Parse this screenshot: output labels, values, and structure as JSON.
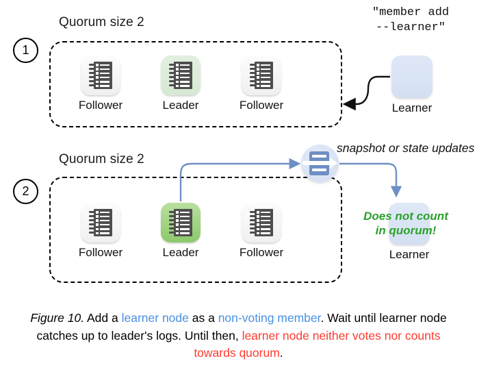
{
  "figure": {
    "number": "Figure 10.",
    "caption_parts": [
      {
        "text": "Figure 10.",
        "style": "italic"
      },
      {
        "text": " Add a ",
        "style": "plain"
      },
      {
        "text": "learner node",
        "style": "blue"
      },
      {
        "text": " as a ",
        "style": "plain"
      },
      {
        "text": "non-voting member",
        "style": "blue"
      },
      {
        "text": ". Wait until learner node catches up to leader's logs. Until then, ",
        "style": "plain"
      },
      {
        "text": "learner node neither votes nor counts towards quorum",
        "style": "red"
      },
      {
        "text": ".",
        "style": "plain"
      }
    ],
    "caption_plain": "Figure 10. Add a learner node as a non-voting member. Wait until learner node catches up to leader's logs. Until then, learner node neither votes nor counts towards quorum."
  },
  "colors": {
    "learner_blue": "#4a90e2",
    "warning_red": "#ff3b30",
    "quorum_green": "#2aa02a",
    "leader_green_pale": "#d6e9d2",
    "leader_green_strong": "#8cc96a",
    "learner_box_blue": "#d4e0f2",
    "arrow_blue": "#6e8fc4",
    "arrow_black": "#111111"
  },
  "panels": [
    {
      "step": "1",
      "quorum_label": "Quorum size 2",
      "nodes": [
        {
          "label": "Follower",
          "role": "follower",
          "state": "plain"
        },
        {
          "label": "Leader",
          "role": "leader",
          "state": "green-pale"
        },
        {
          "label": "Follower",
          "role": "follower",
          "state": "plain"
        }
      ],
      "external": {
        "learner_label": "Learner",
        "command": "\"member add\n--learner\""
      }
    },
    {
      "step": "2",
      "quorum_label": "Quorum size 2",
      "nodes": [
        {
          "label": "Follower",
          "role": "follower",
          "state": "plain"
        },
        {
          "label": "Leader",
          "role": "leader",
          "state": "green-strong"
        },
        {
          "label": "Follower",
          "role": "follower",
          "state": "plain"
        }
      ],
      "external": {
        "learner_label": "Learner",
        "sync_label": "snapshot\nor state updates",
        "warning": "Does not count\nin quorum!"
      }
    }
  ]
}
